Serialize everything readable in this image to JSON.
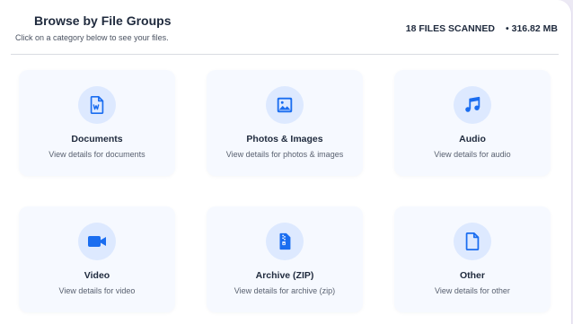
{
  "header": {
    "title": "Browse by File Groups",
    "subtitle": "Click on a category below to see your files.",
    "files_scanned": "18 FILES SCANNED",
    "separator": "•",
    "total_size": "316.82 MB"
  },
  "colors": {
    "accent": "#1a6df0",
    "icon_bg": "#dde9ff",
    "card_bg": "#f6f9ff"
  },
  "categories": [
    {
      "title": "Documents",
      "description": "View details for documents",
      "icon": "document-icon"
    },
    {
      "title": "Photos & Images",
      "description": "View details for photos & images",
      "icon": "image-icon"
    },
    {
      "title": "Audio",
      "description": "View details for audio",
      "icon": "music-note-icon"
    },
    {
      "title": "Video",
      "description": "View details for video",
      "icon": "video-camera-icon"
    },
    {
      "title": "Archive (ZIP)",
      "description": "View details for archive (zip)",
      "icon": "zip-file-icon"
    },
    {
      "title": "Other",
      "description": "View details for other",
      "icon": "file-icon"
    }
  ]
}
